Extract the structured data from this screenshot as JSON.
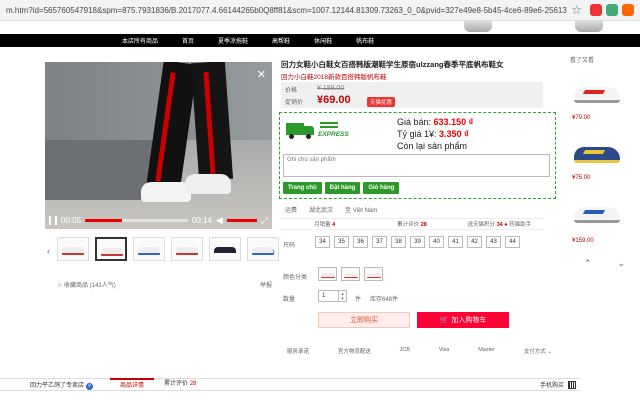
{
  "browser": {
    "url": "m.htm?id=565760547918&spm=875.7931836/B.2017077.4.66144265b0Q8ff81&scm=1007.12144.81309.73263_0_0&pvid=327e49e8-5b45-4ce6-89e6-2561305a9853&utparam=%7B%"
  },
  "nav": {
    "items": [
      "本店所有商品",
      "首页",
      "夏季凉拖鞋",
      "高帮鞋",
      "休闲鞋",
      "帆布鞋"
    ]
  },
  "video": {
    "current_time": "00:05",
    "duration": "00:14",
    "progress_fraction": 0.36
  },
  "gallery": {
    "thumbnails": [
      "white-red",
      "white-red-active",
      "white-blue",
      "white-red-low",
      "navy-white",
      "white-blue-low"
    ]
  },
  "favorites": {
    "collect_label": "收藏商品",
    "popularity": "(141人气)",
    "report_label": "举报"
  },
  "product": {
    "title": "回力女鞋小白鞋女百搭韩版潮鞋学生原宿ulzzang春季平底帆布鞋女",
    "subtitle": "回力小白鞋2018新款百搭韩版帆布鞋",
    "price_label": "价格",
    "old_price": "¥ 189.00",
    "promo_label": "促销价",
    "new_price": "¥69.00",
    "promo_badge": "天猫优惠"
  },
  "extension": {
    "brand": "EXPRESS",
    "price_label": "Giá bán:",
    "price_value": "633.150 ₫",
    "rate_label": "Tỷ giá 1¥:",
    "rate_value": "3.350 ₫",
    "stock_text": "Còn lại sản phẩm",
    "note_placeholder": "Ghi chú sản phẩm",
    "buttons": [
      "Trang chủ",
      "Đặt hàng",
      "Giỏ hàng"
    ]
  },
  "shipping": {
    "label": "运费",
    "from": "湖北武汉",
    "to": "至 Việt Nam"
  },
  "stats": {
    "monthly_sales_label": "月销量",
    "monthly_sales": "4",
    "reviews_label": "累计评价",
    "reviews": "28",
    "points_label": "送天猫积分",
    "points": "34",
    "coins_label": "药猫助手"
  },
  "sku": {
    "size_label": "尺码",
    "sizes": [
      "34",
      "35",
      "36",
      "37",
      "38",
      "39",
      "40",
      "41",
      "42",
      "43",
      "44"
    ],
    "color_label": "颜色分类",
    "quantity_label": "数量",
    "quantity": "1",
    "unit": "件",
    "stock": "库存648件"
  },
  "actions": {
    "buy_now": "立即购买",
    "add_to_cart": "加入购物车"
  },
  "services": [
    "服务承诺",
    "官方物流配送",
    "JCB",
    "Visa",
    "Master",
    "支付方式"
  ],
  "tabs": {
    "shop": "回力平乙鸽了专卖店",
    "shop_badge": "v",
    "items": [
      "商品详情",
      "累计评价"
    ],
    "reviews_count": "28",
    "mobile_order": "手机购买"
  },
  "sidebar": {
    "title": "看了又看",
    "prices": [
      "¥79.00",
      "¥75.00",
      "¥159.00"
    ]
  }
}
